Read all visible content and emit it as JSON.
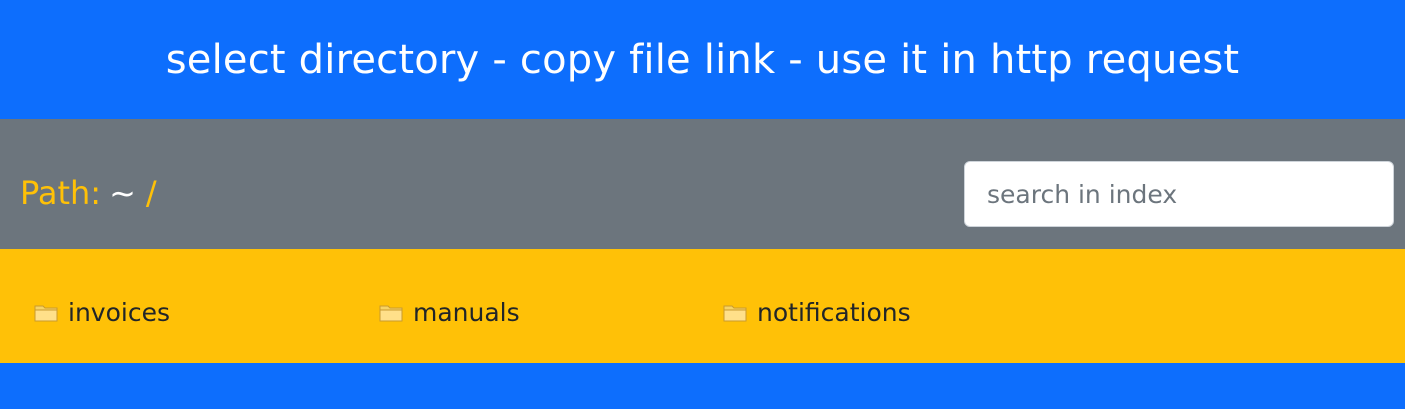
{
  "header": {
    "title": "select directory - copy file link - use it in http request"
  },
  "pathbar": {
    "label": "Path:",
    "home": "~",
    "separator": "/"
  },
  "search": {
    "placeholder": "search in index",
    "value": ""
  },
  "directories": [
    {
      "name": "invoices",
      "icon": "folder-icon"
    },
    {
      "name": "manuals",
      "icon": "folder-icon"
    },
    {
      "name": "notifications",
      "icon": "folder-icon"
    }
  ],
  "colors": {
    "primary": "#0d6efd",
    "secondary": "#6c757d",
    "warning": "#ffc107",
    "text_dark": "#212529",
    "white": "#ffffff"
  }
}
